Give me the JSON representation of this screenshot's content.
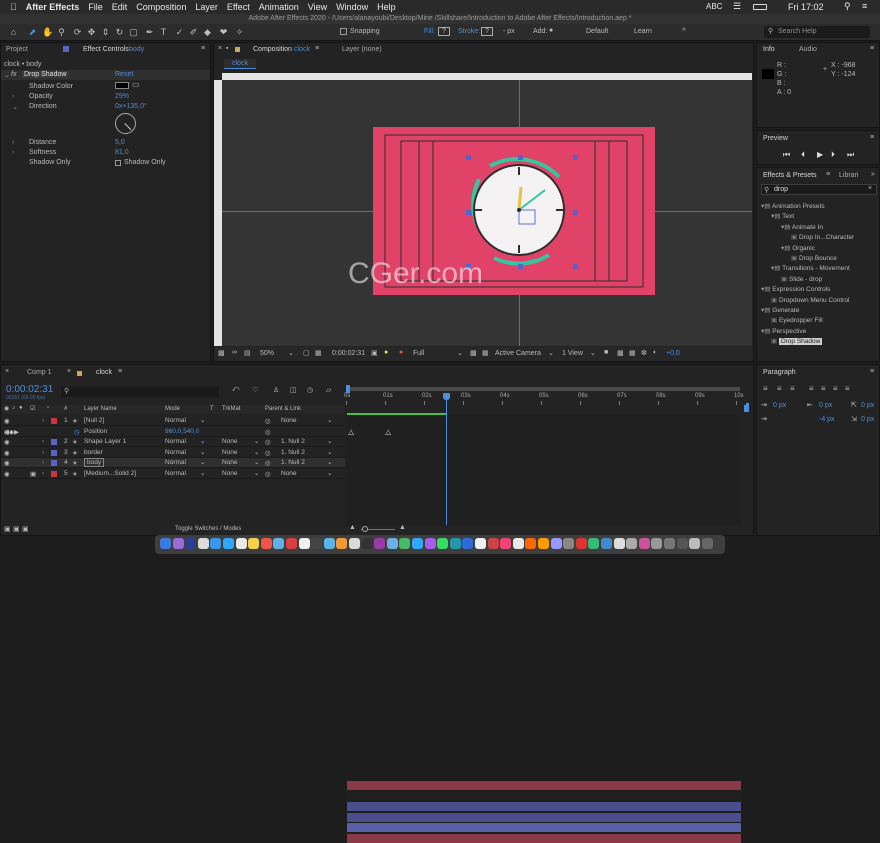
{
  "menubar": {
    "app": "After Effects",
    "items": [
      "File",
      "Edit",
      "Composition",
      "Layer",
      "Effect",
      "Animation",
      "View",
      "Window",
      "Help"
    ],
    "clock": "Fri 17:02",
    "keyboard": "ABC"
  },
  "titlebar": {
    "text": "Adobe After Effects 2020 - /Users/alanayoubi/Desktop/Mine /Skillshare/Introduction to Adobe After Effects/Introduction.aep *"
  },
  "toolbar": {
    "snapping": "Snapping",
    "fill": "Fill:",
    "stroke": "Stroke:",
    "stroke_width": "- px",
    "add": "Add:",
    "default": "Default",
    "learn": "Learn",
    "search_help": "Search Help"
  },
  "effect_controls": {
    "tab_project": "Project",
    "tab_effect_controls": "Effect Controls",
    "tab_layer_name": "body",
    "breadcrumb": "clock • body",
    "fx_label": "fx",
    "effect_name": "Drop Shadow",
    "reset": "Reset",
    "props": [
      {
        "name": "Shadow Color",
        "value": ""
      },
      {
        "name": "Opacity",
        "value": "29%"
      },
      {
        "name": "Direction",
        "value": "0x+135,0°"
      },
      {
        "name": "Distance",
        "value": "5,0"
      },
      {
        "name": "Softness",
        "value": "81,0"
      },
      {
        "name": "Shadow Only",
        "value": "Shadow Only"
      }
    ]
  },
  "composition": {
    "tab_label": "Composition",
    "comp_name": "clock",
    "layer_tab": "Layer (none)",
    "sub_tab": "clock",
    "zoom": "50%",
    "timecode": "0:00:02:31",
    "resolution": "Full",
    "camera": "Active Camera",
    "views": "1 View",
    "exposure": "+0,0"
  },
  "info": {
    "tab_info": "Info",
    "tab_audio": "Audio",
    "r": "R :",
    "g": "G :",
    "b": "B :",
    "a": "A :  0",
    "x": "X : -968",
    "y": "Y : -124"
  },
  "preview": {
    "title": "Preview"
  },
  "effects_presets": {
    "title": "Effects & Presets",
    "tab2": "Librari",
    "search": "drop",
    "tree": [
      {
        "label": "Animation Presets",
        "level": 0,
        "folder": true
      },
      {
        "label": "Text",
        "level": 1,
        "folder": true
      },
      {
        "label": "Animate In",
        "level": 2,
        "folder": true
      },
      {
        "label": "Drop In...Character",
        "level": 3,
        "folder": false
      },
      {
        "label": "Organic",
        "level": 2,
        "folder": true
      },
      {
        "label": "Drop Bounce",
        "level": 3,
        "folder": false
      },
      {
        "label": "Transitions - Movement",
        "level": 1,
        "folder": true
      },
      {
        "label": "Slide - drop",
        "level": 2,
        "folder": false
      },
      {
        "label": "Expression Controls",
        "level": 0,
        "folder": true
      },
      {
        "label": "Dropdown Menu Control",
        "level": 1,
        "folder": false
      },
      {
        "label": "Generate",
        "level": 0,
        "folder": true
      },
      {
        "label": "Eyedropper Fill",
        "level": 1,
        "folder": false
      },
      {
        "label": "Perspective",
        "level": 0,
        "folder": true
      },
      {
        "label": "Drop Shadow",
        "level": 1,
        "folder": false,
        "selected": true
      }
    ]
  },
  "paragraph": {
    "title": "Paragraph",
    "fields": [
      "0 px",
      "0 px",
      "0 px",
      "-4 px",
      "0 px"
    ]
  },
  "timeline": {
    "tab_render": "Comp 1",
    "tab_comp": "clock",
    "timecode": "0:00:02:31",
    "frame_info": "00151 (60.00 fps)",
    "search_placeholder": "",
    "columns": {
      "num": "#",
      "name": "Layer Name",
      "mode": "Mode",
      "t": "T",
      "trkmat": "TrkMat",
      "parent": "Parent & Link"
    },
    "layers": [
      {
        "num": "1",
        "name": "[Null 2]",
        "mode": "Normal",
        "trkmat": "",
        "parent": "None",
        "color": "#c8343f"
      },
      {
        "num": "",
        "name": "Position",
        "mode": "",
        "trkmat": "",
        "parent": "",
        "value": "960,0,540,0",
        "color": ""
      },
      {
        "num": "2",
        "name": "Shape Layer 1",
        "mode": "Normal",
        "trkmat": "None",
        "parent": "1. Null 2",
        "color": "#5a62c8"
      },
      {
        "num": "3",
        "name": "border",
        "mode": "Normal",
        "trkmat": "None",
        "parent": "1. Null 2",
        "color": "#5a62c8"
      },
      {
        "num": "4",
        "name": "body",
        "mode": "Normal",
        "trkmat": "None",
        "parent": "1. Null 2",
        "color": "#5a62c8"
      },
      {
        "num": "5",
        "name": "[Medium...Solid 2]",
        "mode": "Normal",
        "trkmat": "None",
        "parent": "None",
        "color": "#c8343f"
      }
    ],
    "ruler": [
      "0s",
      "01s",
      "02s",
      "03s",
      "04s",
      "05s",
      "06s",
      "07s",
      "08s",
      "09s",
      "10s"
    ],
    "toggle_label": "Toggle Switches / Modes"
  },
  "watermark": "CGer.com"
}
